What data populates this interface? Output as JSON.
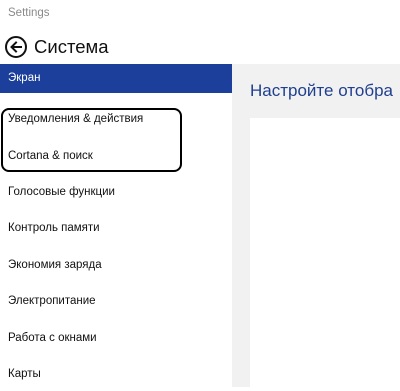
{
  "window": {
    "title": "Settings"
  },
  "header": {
    "title": "Система"
  },
  "sidebar": {
    "items": [
      {
        "label": "Экран"
      },
      {
        "label": "Уведомления & действия"
      },
      {
        "label": "Cortana & поиск"
      },
      {
        "label": "Голосовые функции"
      },
      {
        "label": "Контроль памяти"
      },
      {
        "label": "Экономия заряда"
      },
      {
        "label": "Электропитание"
      },
      {
        "label": "Работа с окнами"
      },
      {
        "label": "Карты"
      }
    ]
  },
  "main": {
    "heading": "Настройте отобра"
  },
  "colors": {
    "accent": "#1b3f9b",
    "heading": "#1f3f8f",
    "annotation": "#000000"
  }
}
